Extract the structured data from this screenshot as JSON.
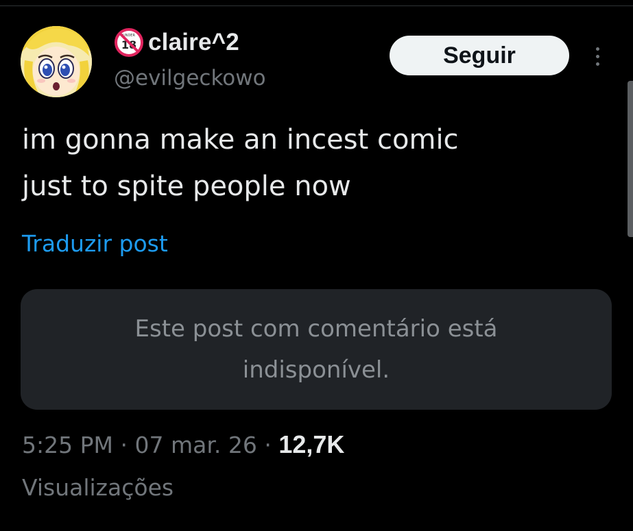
{
  "author": {
    "display_name": "claire^2",
    "handle": "@evilgeckowo",
    "badge_icon": "under-18-icon",
    "avatar_icon": "cartoon-avatar-icon"
  },
  "actions": {
    "follow_label": "Seguir",
    "more_icon": "more-vertical-icon"
  },
  "post": {
    "lines": [
      "im gonna make an incest comic",
      "just to spite people now"
    ],
    "translate_label": "Traduzir post"
  },
  "quote": {
    "lines": [
      "Este post com comentário está",
      "indisponível."
    ]
  },
  "meta": {
    "time": "5:25 PM",
    "separator": "·",
    "date": "07 mar. 26",
    "views_count": "12,7K",
    "views_label": "Visualizações"
  },
  "colors": {
    "background": "#000000",
    "text_primary": "#e7e9ea",
    "text_secondary": "#71767b",
    "link": "#1d9bf0",
    "button_bg": "#eff3f4",
    "card_bg": "#202327"
  }
}
